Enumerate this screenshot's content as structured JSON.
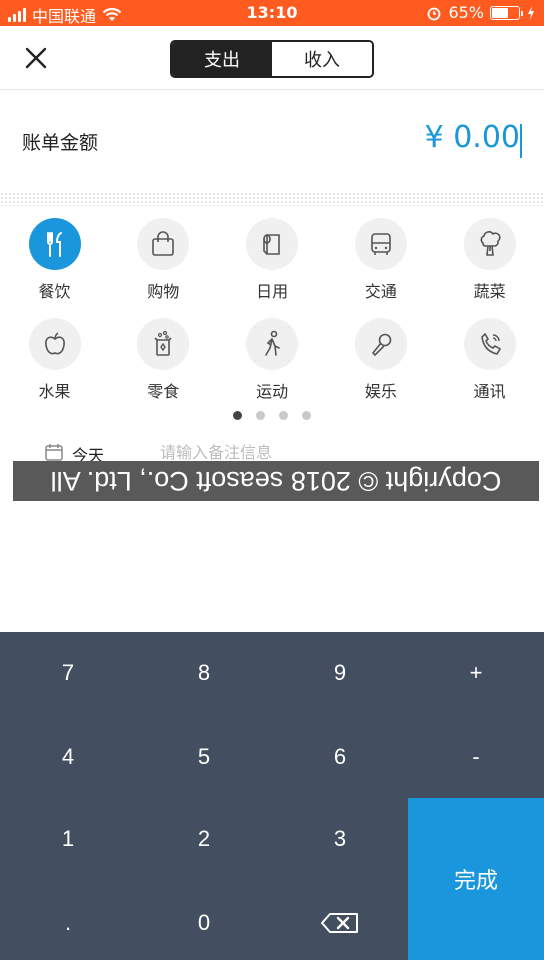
{
  "status_bar": {
    "carrier": "中国联通",
    "time": "13:10",
    "battery": "65%",
    "battery_level": 0.65
  },
  "header": {
    "tabs": [
      "支出",
      "收入"
    ],
    "active_tab": 0
  },
  "amount": {
    "label": "账单金额",
    "value": "¥ 0.00"
  },
  "categories": [
    {
      "label": "餐饮",
      "icon": "utensils-icon",
      "selected": true
    },
    {
      "label": "购物",
      "icon": "shopping-bag-icon",
      "selected": false
    },
    {
      "label": "日用",
      "icon": "tissue-roll-icon",
      "selected": false
    },
    {
      "label": "交通",
      "icon": "bus-icon",
      "selected": false
    },
    {
      "label": "蔬菜",
      "icon": "broccoli-icon",
      "selected": false
    },
    {
      "label": "水果",
      "icon": "apple-icon",
      "selected": false
    },
    {
      "label": "零食",
      "icon": "snack-icon",
      "selected": false
    },
    {
      "label": "运动",
      "icon": "running-icon",
      "selected": false
    },
    {
      "label": "娱乐",
      "icon": "microphone-icon",
      "selected": false
    },
    {
      "label": "通讯",
      "icon": "phone-icon",
      "selected": false
    }
  ],
  "pager": {
    "pages": 4,
    "current": 0
  },
  "note": {
    "date_label": "今天",
    "placeholder": "请输入备注信息"
  },
  "watermark": "Copyright © 2018 seasoft Co., Ltd. All",
  "keypad": {
    "rows": [
      [
        "7",
        "8",
        "9",
        "+"
      ],
      [
        "4",
        "5",
        "6",
        "-"
      ],
      [
        "1",
        "2",
        "3"
      ],
      [
        ".",
        "0",
        "backspace-icon"
      ]
    ],
    "done_label": "完成"
  },
  "colors": {
    "status_bar": "#ff5a1f",
    "accent": "#1a96dc",
    "keypad_bg": "#434f60"
  }
}
